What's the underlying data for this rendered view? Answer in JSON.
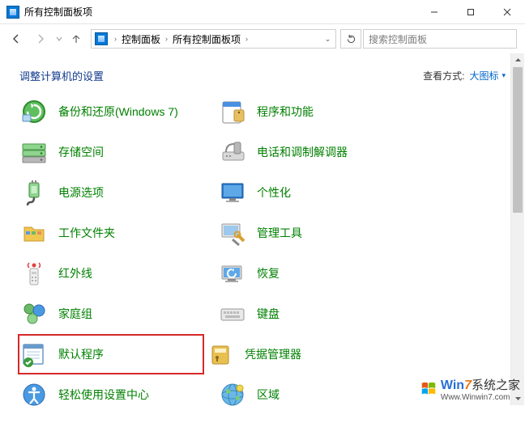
{
  "window": {
    "title": "所有控制面板项"
  },
  "nav": {
    "breadcrumbs": [
      "控制面板",
      "所有控制面板项"
    ],
    "search_placeholder": "搜索控制面板"
  },
  "heading": {
    "title": "调整计算机的设置",
    "view_label": "查看方式:",
    "view_value": "大图标"
  },
  "items": {
    "left": [
      {
        "id": "backup-restore",
        "label": "备份和还原(Windows 7)"
      },
      {
        "id": "storage-spaces",
        "label": "存储空间"
      },
      {
        "id": "power-options",
        "label": "电源选项"
      },
      {
        "id": "work-folders",
        "label": "工作文件夹"
      },
      {
        "id": "infrared",
        "label": "红外线"
      },
      {
        "id": "homegroup",
        "label": "家庭组"
      },
      {
        "id": "default-programs",
        "label": "默认程序"
      },
      {
        "id": "ease-of-access",
        "label": "轻松使用设置中心"
      }
    ],
    "right": [
      {
        "id": "programs-features",
        "label": "程序和功能"
      },
      {
        "id": "phone-modem",
        "label": "电话和调制解调器"
      },
      {
        "id": "personalization",
        "label": "个性化"
      },
      {
        "id": "admin-tools",
        "label": "管理工具"
      },
      {
        "id": "recovery",
        "label": "恢复"
      },
      {
        "id": "keyboard",
        "label": "键盘"
      },
      {
        "id": "credential-manager",
        "label": "凭据管理器"
      },
      {
        "id": "region",
        "label": "区域"
      }
    ]
  },
  "watermark": {
    "brand_a": "W",
    "brand_b": "in",
    "brand_c": "7",
    "brand_suffix": "系统之家",
    "url": "Www.Winwin7.com"
  }
}
